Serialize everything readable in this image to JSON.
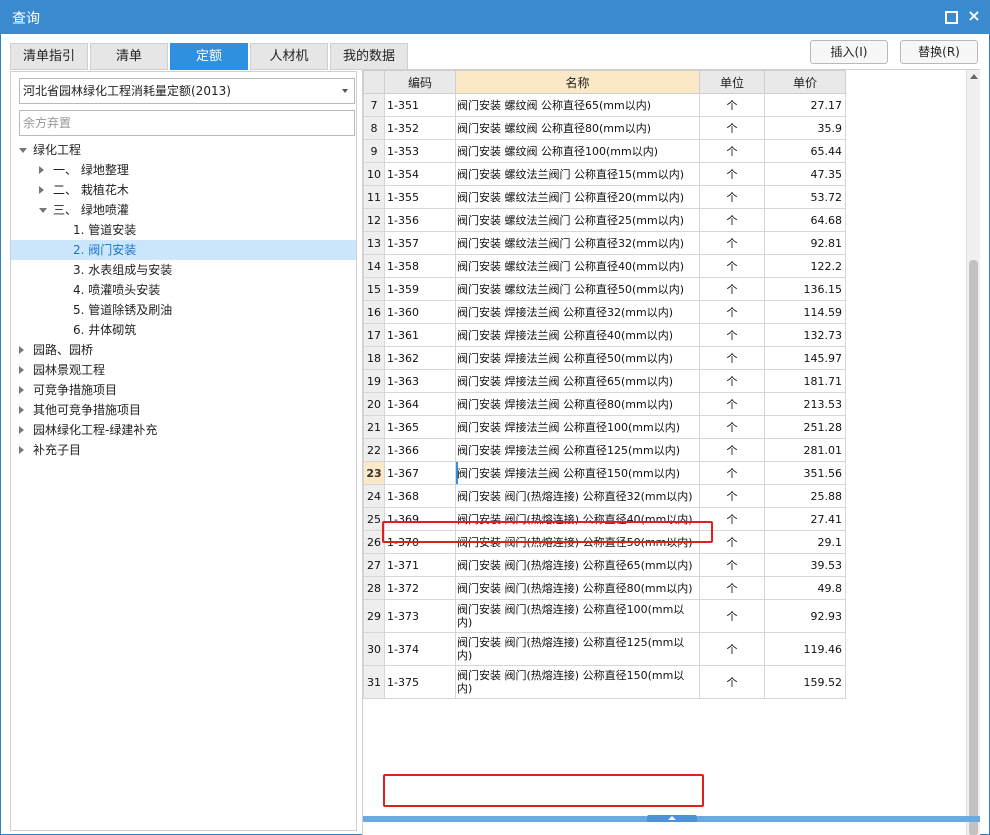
{
  "window": {
    "title": "查询"
  },
  "tabs": [
    {
      "label": "清单指引",
      "active": false
    },
    {
      "label": "清单",
      "active": false
    },
    {
      "label": "定额",
      "active": true
    },
    {
      "label": "人材机",
      "active": false
    },
    {
      "label": "我的数据",
      "active": false
    }
  ],
  "actions": {
    "insert": "插入(I)",
    "replace": "替换(R)"
  },
  "left": {
    "library": "河北省园林绿化工程消耗量定额(2013)",
    "search_placeholder": "余方弃置"
  },
  "tree": [
    {
      "label": "绿化工程",
      "level": 0,
      "state": "expanded"
    },
    {
      "label": "一、 绿地整理",
      "level": 1,
      "state": "collapsed"
    },
    {
      "label": "二、 栽植花木",
      "level": 1,
      "state": "collapsed"
    },
    {
      "label": "三、 绿地喷灌",
      "level": 1,
      "state": "expanded"
    },
    {
      "label": "1. 管道安装",
      "level": 2,
      "state": "leaf"
    },
    {
      "label": "2. 阀门安装",
      "level": 2,
      "state": "leaf",
      "selected": true
    },
    {
      "label": "3. 水表组成与安装",
      "level": 2,
      "state": "leaf"
    },
    {
      "label": "4. 喷灌喷头安装",
      "level": 2,
      "state": "leaf"
    },
    {
      "label": "5. 管道除锈及刷油",
      "level": 2,
      "state": "leaf"
    },
    {
      "label": "6. 井体砌筑",
      "level": 2,
      "state": "leaf"
    },
    {
      "label": "园路、园桥",
      "level": 0,
      "state": "collapsed"
    },
    {
      "label": "园林景观工程",
      "level": 0,
      "state": "collapsed"
    },
    {
      "label": "可竞争措施项目",
      "level": 0,
      "state": "collapsed"
    },
    {
      "label": "其他可竞争措施项目",
      "level": 0,
      "state": "collapsed"
    },
    {
      "label": "园林绿化工程-绿建补充",
      "level": 0,
      "state": "collapsed"
    },
    {
      "label": "补充子目",
      "level": 0,
      "state": "collapsed"
    }
  ],
  "grid": {
    "columns": {
      "code": "编码",
      "name": "名称",
      "unit": "单位",
      "price": "单价"
    },
    "rows": [
      {
        "n": "7",
        "code": "1-351",
        "name": "阀门安装 螺纹阀 公称直径65(mm以内)",
        "unit": "个",
        "price": "27.17"
      },
      {
        "n": "8",
        "code": "1-352",
        "name": "阀门安装 螺纹阀 公称直径80(mm以内)",
        "unit": "个",
        "price": "35.9"
      },
      {
        "n": "9",
        "code": "1-353",
        "name": "阀门安装 螺纹阀 公称直径100(mm以内)",
        "unit": "个",
        "price": "65.44"
      },
      {
        "n": "10",
        "code": "1-354",
        "name": "阀门安装 螺纹法兰阀门 公称直径15(mm以内)",
        "unit": "个",
        "price": "47.35"
      },
      {
        "n": "11",
        "code": "1-355",
        "name": "阀门安装 螺纹法兰阀门 公称直径20(mm以内)",
        "unit": "个",
        "price": "53.72"
      },
      {
        "n": "12",
        "code": "1-356",
        "name": "阀门安装 螺纹法兰阀门 公称直径25(mm以内)",
        "unit": "个",
        "price": "64.68"
      },
      {
        "n": "13",
        "code": "1-357",
        "name": "阀门安装 螺纹法兰阀门 公称直径32(mm以内)",
        "unit": "个",
        "price": "92.81"
      },
      {
        "n": "14",
        "code": "1-358",
        "name": "阀门安装 螺纹法兰阀门 公称直径40(mm以内)",
        "unit": "个",
        "price": "122.2"
      },
      {
        "n": "15",
        "code": "1-359",
        "name": "阀门安装 螺纹法兰阀门 公称直径50(mm以内)",
        "unit": "个",
        "price": "136.15"
      },
      {
        "n": "16",
        "code": "1-360",
        "name": "阀门安装 焊接法兰阀 公称直径32(mm以内)",
        "unit": "个",
        "price": "114.59"
      },
      {
        "n": "17",
        "code": "1-361",
        "name": "阀门安装 焊接法兰阀 公称直径40(mm以内)",
        "unit": "个",
        "price": "132.73"
      },
      {
        "n": "18",
        "code": "1-362",
        "name": "阀门安装 焊接法兰阀 公称直径50(mm以内)",
        "unit": "个",
        "price": "145.97"
      },
      {
        "n": "19",
        "code": "1-363",
        "name": "阀门安装 焊接法兰阀 公称直径65(mm以内)",
        "unit": "个",
        "price": "181.71"
      },
      {
        "n": "20",
        "code": "1-364",
        "name": "阀门安装 焊接法兰阀 公称直径80(mm以内)",
        "unit": "个",
        "price": "213.53"
      },
      {
        "n": "21",
        "code": "1-365",
        "name": "阀门安装 焊接法兰阀 公称直径100(mm以内)",
        "unit": "个",
        "price": "251.28"
      },
      {
        "n": "22",
        "code": "1-366",
        "name": "阀门安装 焊接法兰阀 公称直径125(mm以内)",
        "unit": "个",
        "price": "281.01"
      },
      {
        "n": "23",
        "code": "1-367",
        "name": "阀门安装 焊接法兰阀 公称直径150(mm以内)",
        "unit": "个",
        "price": "351.56",
        "current": true
      },
      {
        "n": "24",
        "code": "1-368",
        "name": "阀门安装 阀门(热熔连接) 公称直径32(mm以内)",
        "unit": "个",
        "price": "25.88"
      },
      {
        "n": "25",
        "code": "1-369",
        "name": "阀门安装 阀门(热熔连接) 公称直径40(mm以内)",
        "unit": "个",
        "price": "27.41"
      },
      {
        "n": "26",
        "code": "1-370",
        "name": "阀门安装 阀门(热熔连接) 公称直径50(mm以内)",
        "unit": "个",
        "price": "29.1"
      },
      {
        "n": "27",
        "code": "1-371",
        "name": "阀门安装 阀门(热熔连接) 公称直径65(mm以内)",
        "unit": "个",
        "price": "39.53"
      },
      {
        "n": "28",
        "code": "1-372",
        "name": "阀门安装 阀门(热熔连接) 公称直径80(mm以内)",
        "unit": "个",
        "price": "49.8"
      },
      {
        "n": "29",
        "code": "1-373",
        "name": "阀门安装 阀门(热熔连接) 公称直径100(mm以内)",
        "unit": "个",
        "price": "92.93"
      },
      {
        "n": "30",
        "code": "1-374",
        "name": "阀门安装 阀门(热熔连接) 公称直径125(mm以内)",
        "unit": "个",
        "price": "119.46"
      },
      {
        "n": "31",
        "code": "1-375",
        "name": "阀门安装 阀门(热熔连接) 公称直径150(mm以内)",
        "unit": "个",
        "price": "159.52"
      }
    ]
  }
}
